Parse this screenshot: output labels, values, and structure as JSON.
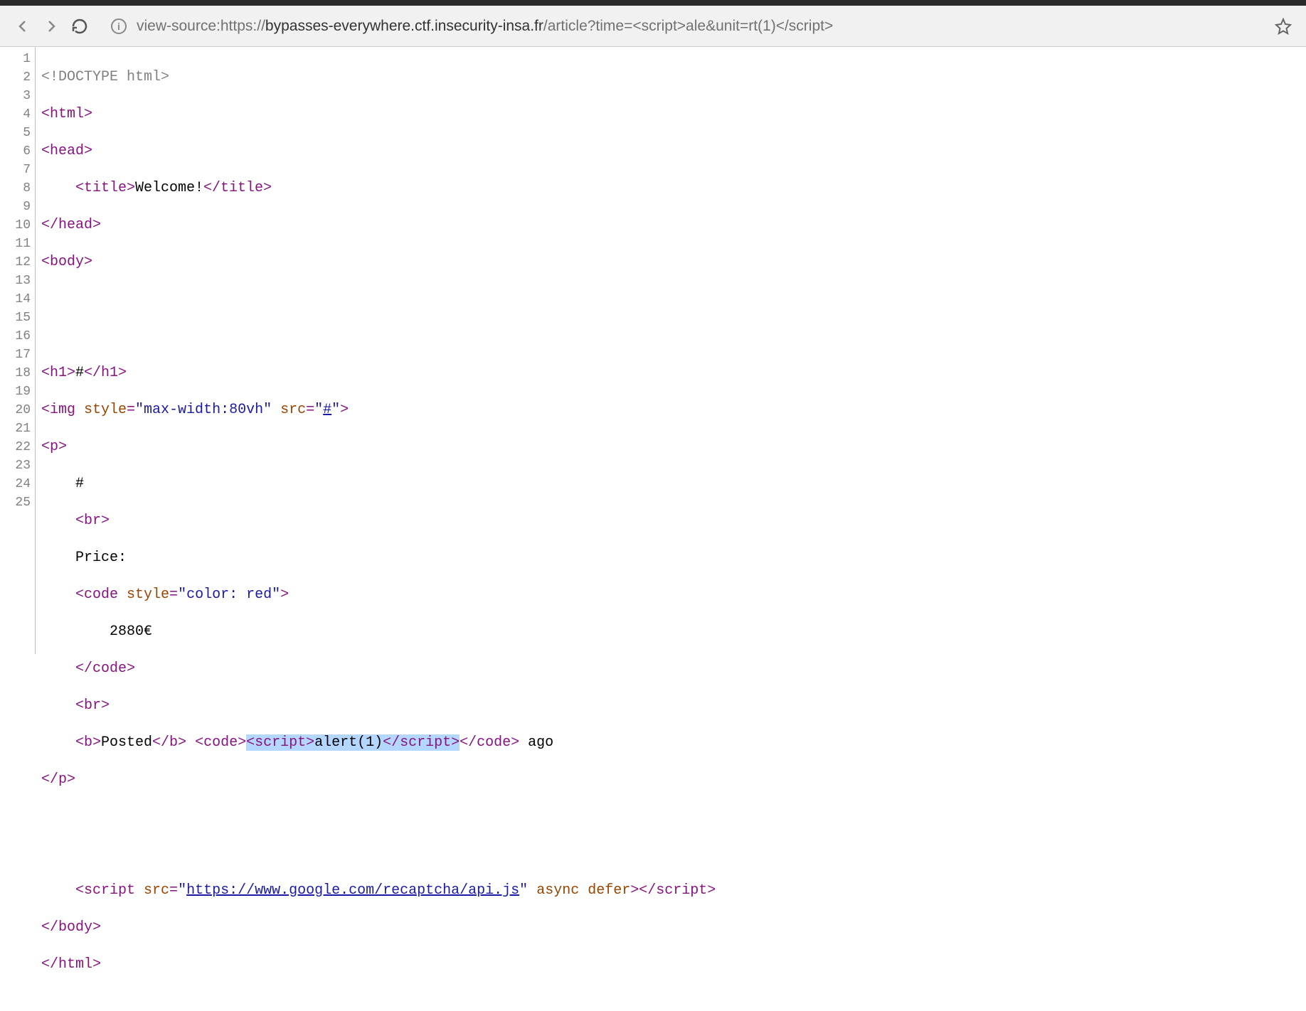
{
  "url": {
    "prefix": "view-source:https://",
    "host": "bypasses-everywhere.ctf.insecurity-insa.fr",
    "path": "/article?time=<script>ale&unit=rt(1)</scr",
    "path_end": "ipt>"
  },
  "line_count": 25,
  "source": {
    "l1": "<!DOCTYPE html>",
    "l2": "<html>",
    "l3": "<head>",
    "l4_open": "<title>",
    "l4_text": "Welcome!",
    "l4_close": "</title>",
    "l5": "</head>",
    "l6": "<body>",
    "l9_open": "<h1>",
    "l9_text": "#",
    "l9_close": "</h1>",
    "l10_open": "<img ",
    "l10_attr1": "style",
    "l10_val1": "\"max-width:80vh\"",
    "l10_attr2": "src",
    "l10_val2_link": "#",
    "l10_close": ">",
    "l11": "<p>",
    "l12": "#",
    "l13": "<br>",
    "l14": "Price:",
    "l15_open": "<code ",
    "l15_attr": "style",
    "l15_val": "\"color: red\"",
    "l15_close": ">",
    "l16": "2880€",
    "l17": "</code>",
    "l18": "<br>",
    "l19_b_open": "<b>",
    "l19_posted": "Posted",
    "l19_b_close": "</b>",
    "l19_code_open": "<code>",
    "l19_script_open": "<script>",
    "l19_alert": "alert(1)",
    "l19_script_close_part": "</scr",
    "l19_script_close_rest": "ipt>",
    "l19_code_close": "</code>",
    "l19_ago": " ago",
    "l20": "</p>",
    "l23_open": "<script ",
    "l23_attr": "src",
    "l23_link": "https://www.google.com/recaptcha/api.js",
    "l23_async": "async",
    "l23_defer": "defer",
    "l23_close1": ">",
    "l23_close2_part": "</scr",
    "l23_close2_rest": "ipt>",
    "l24": "</body>",
    "l25": "</html>"
  }
}
